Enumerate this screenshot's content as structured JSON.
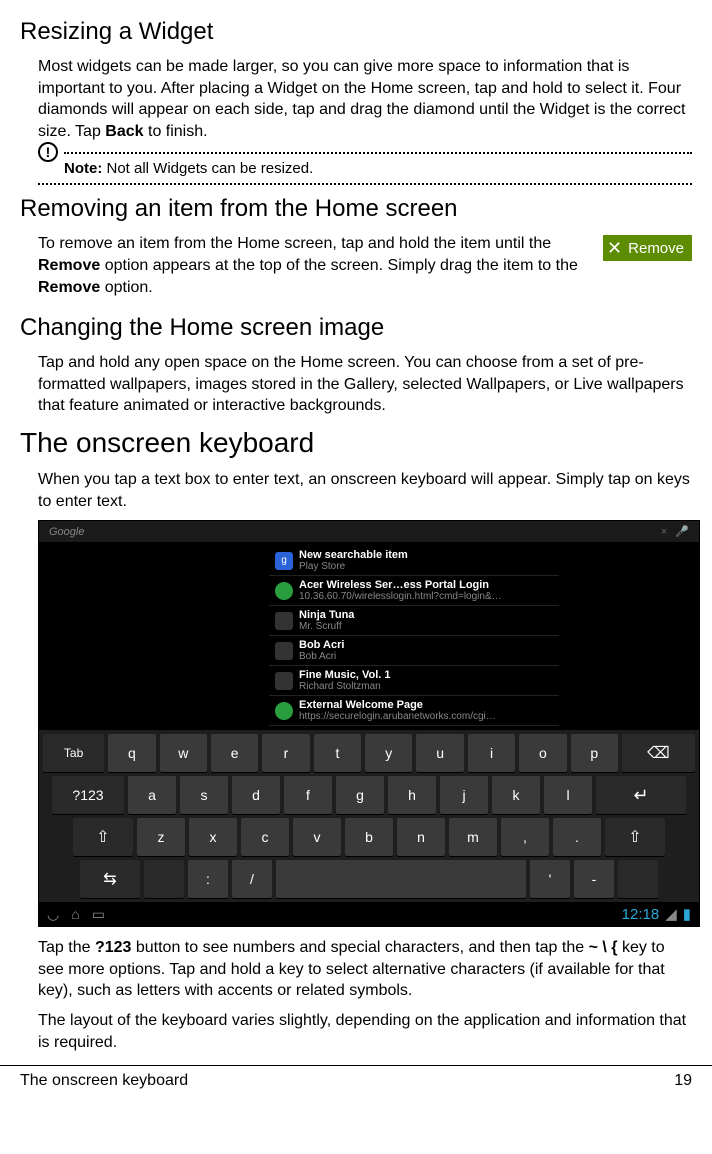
{
  "sections": {
    "resizing": {
      "title": "Resizing a Widget",
      "p1_a": "Most widgets can be made larger, so you can give more space to information that is important to you. After placing a Widget on the Home screen, tap and hold to select it. Four diamonds will appear on each side, tap and drag the diamond until the Widget is the correct size. Tap ",
      "p1_bold": "Back",
      "p1_b": " to finish.",
      "note_label": "Note:",
      "note_text": " Not all Widgets can be resized."
    },
    "removing": {
      "title": "Removing an item from the Home screen",
      "p1_a": "To remove an item from the Home screen, tap and hold the item until the ",
      "p1_b1": "Remove",
      "p1_mid": " option appears at the top of the screen. Simply drag the item to the ",
      "p1_b2": "Remove",
      "p1_end": " option.",
      "badge": "Remove"
    },
    "changing": {
      "title": "Changing the Home screen image",
      "p1": "Tap and hold any open space on the Home screen. You can choose from a set of pre-formatted wallpapers, images stored in the Gallery, selected Wallpapers, or Live wallpapers that feature animated or interactive backgrounds."
    },
    "keyboard": {
      "title": "The onscreen keyboard",
      "p1": "When you tap a text box to enter text, an onscreen keyboard will appear. Simply tap on keys to enter text.",
      "p2_a": "Tap the ",
      "p2_b1": "?123",
      "p2_mid": " button to see numbers and special characters, and then tap the ",
      "p2_b2": "~ \\ {",
      "p2_end": " key to see more options. Tap and hold a key to select alternative characters (if available for that key), such as letters with accents or related symbols.",
      "p3": "The layout of the keyboard varies slightly, depending on the application and information that is required."
    }
  },
  "screenshot": {
    "search_label": "Google",
    "results": [
      {
        "title": "New searchable item",
        "sub": "Play Store",
        "icon": "blue",
        "glyph": "g"
      },
      {
        "title": "Acer Wireless Ser…ess Portal Login",
        "sub": "10.36.60.70/wirelesslogin.html?cmd=login&…",
        "icon": "globe",
        "glyph": ""
      },
      {
        "title": "Ninja Tuna",
        "sub": "Mr. Scruff",
        "icon": "music",
        "glyph": ""
      },
      {
        "title": "Bob Acri",
        "sub": "Bob Acri",
        "icon": "music",
        "glyph": ""
      },
      {
        "title": "Fine Music, Vol. 1",
        "sub": "Richard Stoltzman",
        "icon": "music",
        "glyph": ""
      },
      {
        "title": "External Welcome Page",
        "sub": "https://securelogin.arubanetworks.com/cgi…",
        "icon": "globe",
        "glyph": ""
      }
    ],
    "keys": {
      "row1_tab": "Tab",
      "row1": [
        "q",
        "w",
        "e",
        "r",
        "t",
        "y",
        "u",
        "i",
        "o",
        "p"
      ],
      "row1_bksp": "⌫",
      "row2_mode": "?123",
      "row2": [
        "a",
        "s",
        "d",
        "f",
        "g",
        "h",
        "j",
        "k",
        "l"
      ],
      "row2_enter": "↵",
      "row3_shift": "⇧",
      "row3": [
        "z",
        "x",
        "c",
        "v",
        "b",
        "n",
        "m",
        ",",
        "."
      ],
      "row3_shiftR": "⇧",
      "row4_sym": "⇆",
      "row4_colon": ":",
      "row4_slash": "/",
      "row4_ap": "'",
      "row4_dash": "-"
    },
    "time": "12:18"
  },
  "footer": {
    "left": "The onscreen keyboard",
    "right": "19"
  }
}
